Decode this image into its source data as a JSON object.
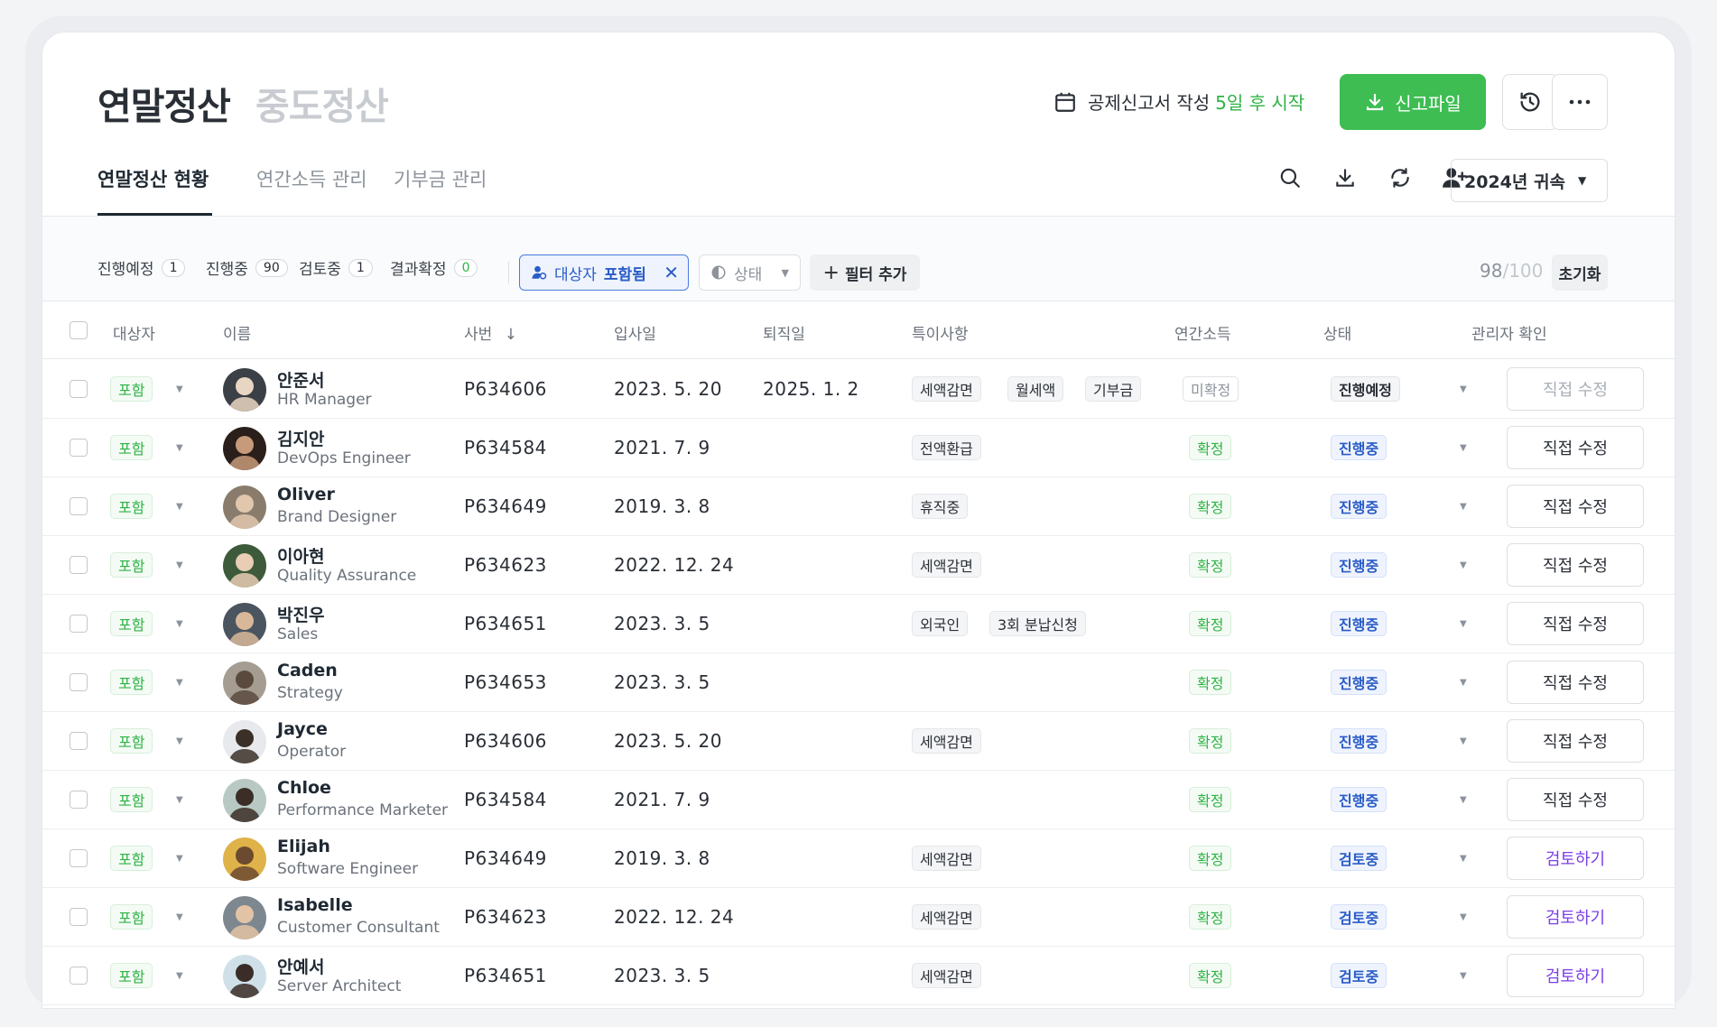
{
  "header": {
    "title": "연말정산",
    "title_secondary": "중도정산",
    "notice_prefix": "공제신고서 작성",
    "notice_highlight": "5일 후 시작",
    "file_button": "신고파일"
  },
  "tabs": [
    "연말정산 현황",
    "연간소득 관리",
    "기부금 관리"
  ],
  "year_select": "2024년 귀속",
  "filters": {
    "stats": [
      {
        "label": "진행예정",
        "count": "1"
      },
      {
        "label": "진행중",
        "count": "90"
      },
      {
        "label": "검토중",
        "count": "1"
      },
      {
        "label": "결과확정",
        "count": "0"
      }
    ],
    "active_filter_key": "대상자",
    "active_filter_value": "포함됨",
    "state_filter": "상태",
    "add_filter": "필터 추가",
    "count": "98",
    "total": "/100",
    "reset": "초기화"
  },
  "columns": {
    "target": "대상자",
    "name": "이름",
    "emp_no": "사번",
    "hire_date": "입사일",
    "leave_date": "퇴직일",
    "notes": "특이사항",
    "income": "연간소득",
    "status": "상태",
    "admin": "관리자 확인"
  },
  "rows": [
    {
      "target": "포함",
      "name": "안준서",
      "role": "HR Manager",
      "emp_no": "P634606",
      "hire": "2023. 5. 20",
      "leave": "2025. 1. 2",
      "notes": [
        "세액감면",
        "월세액",
        "기부금"
      ],
      "income": "미확정",
      "income_kind": "gray",
      "status": "진행예정",
      "status_kind": "status",
      "action": "직접 수정",
      "action_kind": "muted",
      "avatar_bg": "#3b3f46",
      "avatar_fg": "#e9d6c2"
    },
    {
      "target": "포함",
      "name": "김지안",
      "role": "DevOps Engineer",
      "emp_no": "P634584",
      "hire": "2021. 7. 9",
      "leave": "",
      "notes": [
        "전액환급"
      ],
      "income": "확정",
      "income_kind": "green",
      "status": "진행중",
      "status_kind": "blue",
      "action": "직접 수정",
      "action_kind": "normal",
      "avatar_bg": "#2a1f1a",
      "avatar_fg": "#c79a7a"
    },
    {
      "target": "포함",
      "name": "Oliver",
      "role": "Brand Designer",
      "emp_no": "P634649",
      "hire": "2019. 3. 8",
      "leave": "",
      "notes": [
        "휴직중"
      ],
      "income": "확정",
      "income_kind": "green",
      "status": "진행중",
      "status_kind": "blue",
      "action": "직접 수정",
      "action_kind": "normal",
      "avatar_bg": "#8a7c6c",
      "avatar_fg": "#e0c7ad"
    },
    {
      "target": "포함",
      "name": "이아현",
      "role": "Quality Assurance",
      "emp_no": "P634623",
      "hire": "2022. 12. 24",
      "leave": "",
      "notes": [
        "세액감면"
      ],
      "income": "확정",
      "income_kind": "green",
      "status": "진행중",
      "status_kind": "blue",
      "action": "직접 수정",
      "action_kind": "normal",
      "avatar_bg": "#3d5a3a",
      "avatar_fg": "#e9cdb4"
    },
    {
      "target": "포함",
      "name": "박진우",
      "role": "Sales",
      "emp_no": "P634651",
      "hire": "2023. 3. 5",
      "leave": "",
      "notes": [
        "외국인",
        "3회 분납신청"
      ],
      "income": "확정",
      "income_kind": "green",
      "status": "진행중",
      "status_kind": "blue",
      "action": "직접 수정",
      "action_kind": "normal",
      "avatar_bg": "#4a5560",
      "avatar_fg": "#d9b89a"
    },
    {
      "target": "포함",
      "name": "Caden",
      "role": "Strategy",
      "emp_no": "P634653",
      "hire": "2023. 3. 5",
      "leave": "",
      "notes": [],
      "income": "확정",
      "income_kind": "green",
      "status": "진행중",
      "status_kind": "blue",
      "action": "직접 수정",
      "action_kind": "normal",
      "avatar_bg": "#a59d92",
      "avatar_fg": "#5a4a3e"
    },
    {
      "target": "포함",
      "name": "Jayce",
      "role": "Operator",
      "emp_no": "P634606",
      "hire": "2023. 5. 20",
      "leave": "",
      "notes": [
        "세액감면"
      ],
      "income": "확정",
      "income_kind": "green",
      "status": "진행중",
      "status_kind": "blue",
      "action": "직접 수정",
      "action_kind": "normal",
      "avatar_bg": "#e7e9ec",
      "avatar_fg": "#3a3028"
    },
    {
      "target": "포함",
      "name": "Chloe",
      "role": "Performance Marketer",
      "emp_no": "P634584",
      "hire": "2021. 7. 9",
      "leave": "",
      "notes": [],
      "income": "확정",
      "income_kind": "green",
      "status": "진행중",
      "status_kind": "blue",
      "action": "직접 수정",
      "action_kind": "normal",
      "avatar_bg": "#b8c9c4",
      "avatar_fg": "#3b2e27"
    },
    {
      "target": "포함",
      "name": "Elijah",
      "role": "Software Engineer",
      "emp_no": "P634649",
      "hire": "2019. 3. 8",
      "leave": "",
      "notes": [
        "세액감면"
      ],
      "income": "확정",
      "income_kind": "green",
      "status": "검토중",
      "status_kind": "blue",
      "action": "검토하기",
      "action_kind": "purple",
      "avatar_bg": "#e0b24a",
      "avatar_fg": "#6b4a30"
    },
    {
      "target": "포함",
      "name": "Isabelle",
      "role": "Customer Consultant",
      "emp_no": "P634623",
      "hire": "2022. 12. 24",
      "leave": "",
      "notes": [
        "세액감면"
      ],
      "income": "확정",
      "income_kind": "green",
      "status": "검토중",
      "status_kind": "blue",
      "action": "검토하기",
      "action_kind": "purple",
      "avatar_bg": "#7d8790",
      "avatar_fg": "#e3c3a5"
    },
    {
      "target": "포함",
      "name": "안예서",
      "role": "Server Architect",
      "emp_no": "P634651",
      "hire": "2023. 3. 5",
      "leave": "",
      "notes": [
        "세액감면"
      ],
      "income": "확정",
      "income_kind": "green",
      "status": "검토중",
      "status_kind": "blue",
      "action": "검토하기",
      "action_kind": "purple",
      "avatar_bg": "#cfe0e8",
      "avatar_fg": "#3a2c26"
    }
  ],
  "colors": {
    "accent_green": "#3dbd52",
    "accent_blue": "#2a5cc7",
    "accent_purple": "#7b3fe4"
  }
}
